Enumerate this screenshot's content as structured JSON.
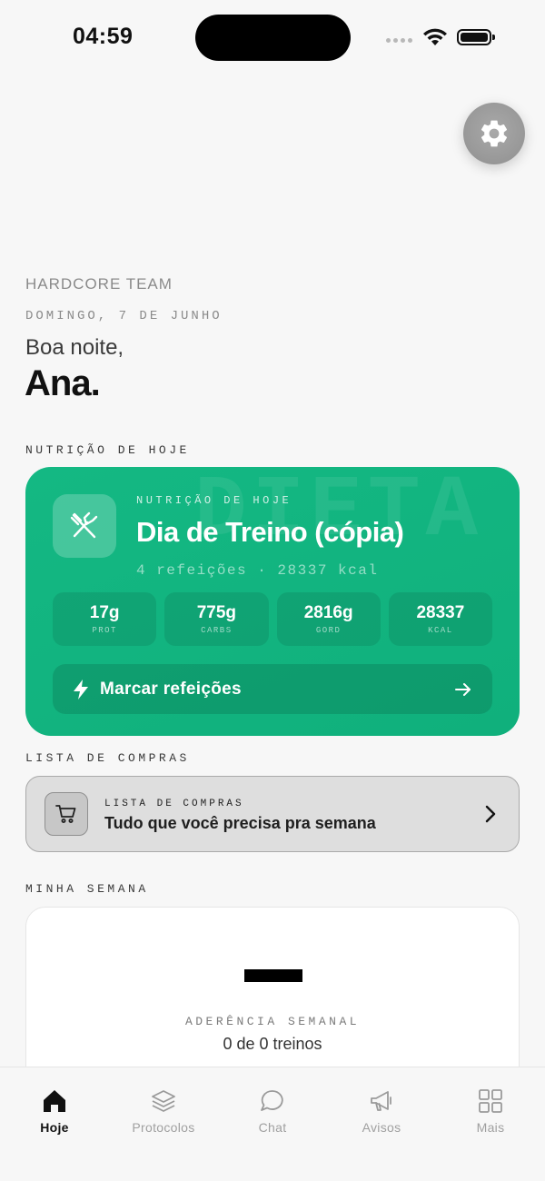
{
  "status_bar": {
    "time": "04:59"
  },
  "header": {
    "team": "HARDCORE TEAM",
    "date": "DOMINGO, 7 DE JUNHO",
    "greeting": "Boa noite,",
    "user_name": "Ana."
  },
  "nutrition": {
    "section_label": "NUTRIÇÃO DE HOJE",
    "watermark": "DIETA",
    "card_overline": "NUTRIÇÃO DE HOJE",
    "title": "Dia de Treino (cópia)",
    "subtitle": "4 refeições · 28337 kcal",
    "macros": [
      {
        "value": "17g",
        "label": "PROT"
      },
      {
        "value": "775g",
        "label": "CARBS"
      },
      {
        "value": "2816g",
        "label": "GORD"
      },
      {
        "value": "28337",
        "label": "KCAL"
      }
    ],
    "action_label": "Marcar refeições",
    "accent_color": "#12b581"
  },
  "shopping": {
    "section_label": "LISTA DE COMPRAS",
    "card_overline": "LISTA DE COMPRAS",
    "title": "Tudo que você precisa pra semana"
  },
  "week": {
    "section_label": "MINHA SEMANA",
    "adherence_label": "ADERÊNCIA SEMANAL",
    "adherence_value": "0 de 0 treinos"
  },
  "tabs": [
    {
      "label": "Hoje",
      "icon": "home-icon",
      "active": true
    },
    {
      "label": "Protocolos",
      "icon": "layers-icon",
      "active": false
    },
    {
      "label": "Chat",
      "icon": "chat-bubble-icon",
      "active": false
    },
    {
      "label": "Avisos",
      "icon": "megaphone-icon",
      "active": false
    },
    {
      "label": "Mais",
      "icon": "grid-icon",
      "active": false
    }
  ]
}
